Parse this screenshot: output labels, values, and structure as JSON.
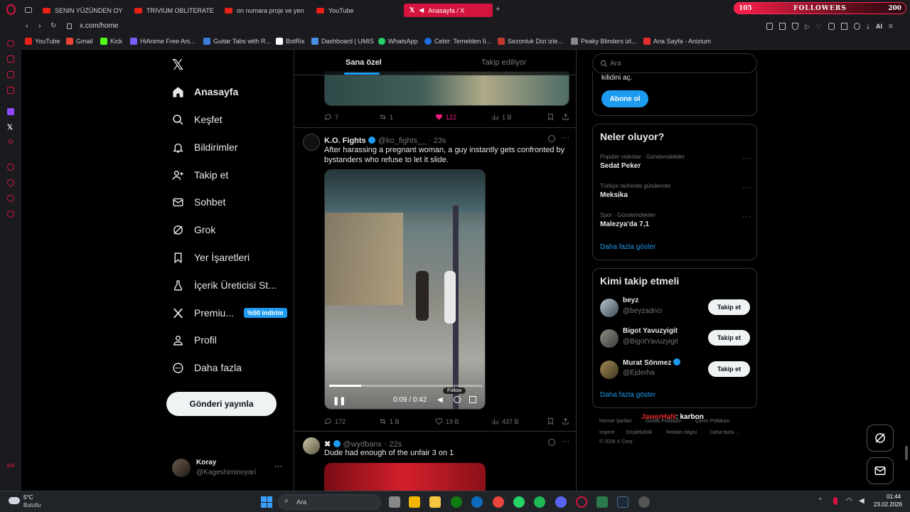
{
  "browser": {
    "tabs": [
      {
        "label": "SENIN YÜZÜNDEN OYUNC"
      },
      {
        "label": "TRIVIUM OBLITERATE"
      },
      {
        "label": "on numara proje ve yeni e"
      },
      {
        "label": "YouTube"
      },
      {
        "label": "Anasayfa / X"
      }
    ],
    "new_tab": "+",
    "url": "x.com/home",
    "ai_label": "AI",
    "followers_widget": {
      "left": "105",
      "label": "FOLLOWERS",
      "right": "200"
    },
    "bookmarks": [
      {
        "label": "YouTube",
        "color": "#e62117"
      },
      {
        "label": "Gmail",
        "color": "#ea4335"
      },
      {
        "label": "Kick",
        "color": "#53fc18"
      },
      {
        "label": "HiAnime Free Ani...",
        "color": "#7a5cff"
      },
      {
        "label": "Guitar Tabs with R...",
        "color": "#3b7dd8"
      },
      {
        "label": "BotRix",
        "color": "#ffffff"
      },
      {
        "label": "Dashboard | UMIS",
        "color": "#4a90e2"
      },
      {
        "label": "WhatsApp",
        "color": "#25d366"
      },
      {
        "label": "Cebir: Temelden İl...",
        "color": "#1d6fdc"
      },
      {
        "label": "Sezonluk Dizi izle...",
        "color": "#c0392b"
      },
      {
        "label": "Peaky Blinders izl...",
        "color": "#888888"
      },
      {
        "label": "Ana Sayfa - Anizium",
        "color": "#e52e2e"
      }
    ]
  },
  "nav": {
    "items": [
      {
        "label": "Anasayfa",
        "icon": "home-icon"
      },
      {
        "label": "Keşfet",
        "icon": "search-icon"
      },
      {
        "label": "Bildirimler",
        "icon": "bell-icon"
      },
      {
        "label": "Takip et",
        "icon": "add-person-icon"
      },
      {
        "label": "Sohbet",
        "icon": "mail-icon"
      },
      {
        "label": "Grok",
        "icon": "grok-icon"
      },
      {
        "label": "Yer İşaretleri",
        "icon": "bookmark-icon"
      },
      {
        "label": "İçerik Üreticisi St...",
        "icon": "flask-icon"
      },
      {
        "label": "Premiu...",
        "icon": "x-icon"
      },
      {
        "label": "Profil",
        "icon": "person-icon"
      },
      {
        "label": "Daha fazla",
        "icon": "more-circle-icon"
      }
    ],
    "premium_badge": "%50 indirim",
    "post_button": "Gönderi yayınla",
    "profile": {
      "name": "Koray",
      "handle": "@Kageshiminoyari",
      "more": "···"
    }
  },
  "feed": {
    "tabs": [
      "Sana özel",
      "Takip ediliyor"
    ],
    "tweet0_stats": {
      "replies": "7",
      "retweets": "1",
      "likes": "122",
      "views": "1 B"
    },
    "tweet1": {
      "name": "K.O. Fights",
      "handle": "@ko_fights__",
      "time": "· 23s",
      "text": "After harassing a pregnant woman, a guy instantly gets confronted by bystanders who refuse to let it slide.",
      "video_time": "0:09 / 0:42",
      "video_progress": 0.21,
      "follow_label": "Follow",
      "stats": {
        "replies": "172",
        "retweets": "1 B",
        "likes": "19 B",
        "views": "437 B"
      }
    },
    "tweet2": {
      "name": "✖",
      "handle": "@wydbanx",
      "time": "· 22s",
      "text": "Dude had enough of the unfair 3 on 1"
    }
  },
  "right": {
    "search_placeholder": "Ara",
    "premium_tail": "kilidini aç.",
    "subscribe_button": "Abone ol",
    "trends_title": "Neler oluyor?",
    "trends": [
      {
        "meta": "Popüler videolar · Gündemdekiler",
        "name": "Sedat Peker"
      },
      {
        "meta": "Türkiye tarihinde gündemde",
        "name": "Meksika"
      },
      {
        "meta": "Spor · Gündemdekiler",
        "name": "Malezya'da 7,1"
      }
    ],
    "show_more": "Daha fazla göster",
    "who_title": "Kimi takip etmeli",
    "who": [
      {
        "name": "beyz",
        "handle": "@beyzadnci",
        "button": "Takip et"
      },
      {
        "name": "Bigot Yavuzyigit",
        "handle": "@BigotYavuzyigit",
        "button": "Takip et"
      },
      {
        "name": "Murat Sönmez",
        "handle": "@Ejderha",
        "button": "Takip et"
      }
    ],
    "who_more": "Daha fazla göster",
    "footer_row1": [
      "Hizmet Şartları",
      "Gizlilik Politikası",
      "Çerez Politikası"
    ],
    "footer_row2": [
      "Imprint",
      "Erişilebilirlik",
      "Reklam bilgisi",
      "Daha fazla ..."
    ],
    "copyright": "© 2026 X Corp.",
    "overlay_a": "JawerHaN",
    "overlay_b": ": karbon"
  },
  "taskbar": {
    "weather_temp": "5°C",
    "weather_text": "Bulutlu",
    "search_label": "Ara",
    "time": "01:44",
    "date": "23.02.2026",
    "counter_badge": "GX"
  }
}
